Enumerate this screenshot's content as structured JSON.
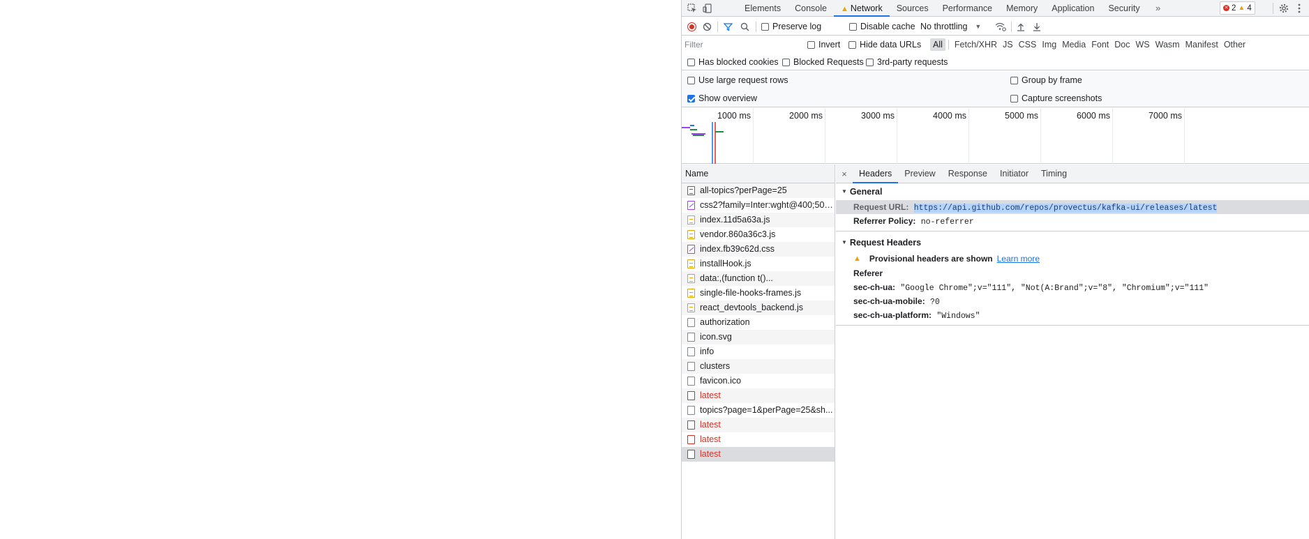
{
  "tabbar": {
    "tabs": [
      {
        "label": "Elements",
        "active": false
      },
      {
        "label": "Console",
        "active": false
      },
      {
        "label": "Network",
        "active": true
      },
      {
        "label": "Sources",
        "active": false
      },
      {
        "label": "Performance",
        "active": false
      },
      {
        "label": "Memory",
        "active": false
      },
      {
        "label": "Application",
        "active": false
      },
      {
        "label": "Security",
        "active": false
      }
    ],
    "overflow_label": "»",
    "error_count": "2",
    "warning_count": "4"
  },
  "toolbar": {
    "preserve_log_label": "Preserve log",
    "preserve_log_checked": false,
    "disable_cache_label": "Disable cache",
    "disable_cache_checked": false,
    "throttling_value": "No throttling"
  },
  "filter": {
    "placeholder": "Filter",
    "invert_label": "Invert",
    "hide_data_urls_label": "Hide data URLs",
    "types": [
      {
        "label": "All",
        "active": true
      },
      {
        "label": "Fetch/XHR",
        "active": false
      },
      {
        "label": "JS",
        "active": false
      },
      {
        "label": "CSS",
        "active": false
      },
      {
        "label": "Img",
        "active": false
      },
      {
        "label": "Media",
        "active": false
      },
      {
        "label": "Font",
        "active": false
      },
      {
        "label": "Doc",
        "active": false
      },
      {
        "label": "WS",
        "active": false
      },
      {
        "label": "Wasm",
        "active": false
      },
      {
        "label": "Manifest",
        "active": false
      },
      {
        "label": "Other",
        "active": false
      }
    ],
    "blocked_cookies_label": "Has blocked cookies",
    "blocked_requests_label": "Blocked Requests",
    "third_party_label": "3rd-party requests"
  },
  "settings": {
    "large_rows_label": "Use large request rows",
    "show_overview_label": "Show overview",
    "show_overview_checked": true,
    "group_by_frame_label": "Group by frame",
    "capture_screenshots_label": "Capture screenshots"
  },
  "overview": {
    "ticks": [
      "1000 ms",
      "2000 ms",
      "3000 ms",
      "4000 ms",
      "5000 ms",
      "6000 ms",
      "7000 ms"
    ]
  },
  "requests": {
    "header": "Name",
    "items": [
      {
        "name": "all-topics?perPage=25",
        "type": "doc",
        "error": false
      },
      {
        "name": "css2?family=Inter:wght@400;500...",
        "type": "css",
        "error": false
      },
      {
        "name": "index.11d5a63a.js",
        "type": "js",
        "error": false
      },
      {
        "name": "vendor.860a36c3.js",
        "type": "js",
        "error": false
      },
      {
        "name": "index.fb39c62d.css",
        "type": "css",
        "error": false
      },
      {
        "name": "installHook.js",
        "type": "js",
        "error": false
      },
      {
        "name": "data:,(function t()...",
        "type": "js",
        "error": false
      },
      {
        "name": "single-file-hooks-frames.js",
        "type": "js",
        "error": false
      },
      {
        "name": "react_devtools_backend.js",
        "type": "js",
        "error": false
      },
      {
        "name": "authorization",
        "type": "other",
        "error": false
      },
      {
        "name": "icon.svg",
        "type": "other",
        "error": false
      },
      {
        "name": "info",
        "type": "other",
        "error": false
      },
      {
        "name": "clusters",
        "type": "other",
        "error": false
      },
      {
        "name": "favicon.ico",
        "type": "other",
        "error": false
      },
      {
        "name": "latest",
        "type": "err",
        "error": true
      },
      {
        "name": "topics?page=1&perPage=25&sh...",
        "type": "other",
        "error": false
      },
      {
        "name": "latest",
        "type": "err",
        "error": true
      },
      {
        "name": "latest",
        "type": "err",
        "error": true
      },
      {
        "name": "latest",
        "type": "err",
        "error": true,
        "selected": true
      }
    ]
  },
  "details": {
    "close_label": "×",
    "tabs": [
      {
        "label": "Headers",
        "active": true
      },
      {
        "label": "Preview",
        "active": false
      },
      {
        "label": "Response",
        "active": false
      },
      {
        "label": "Initiator",
        "active": false
      },
      {
        "label": "Timing",
        "active": false
      }
    ],
    "general": {
      "title": "General",
      "request_url_key": "Request URL:",
      "request_url_value": "https://api.github.com/repos/provectus/kafka-ui/releases/latest",
      "referrer_policy_key": "Referrer Policy:",
      "referrer_policy_value": "no-referrer"
    },
    "request_headers": {
      "title": "Request Headers",
      "provisional_text": "Provisional headers are shown",
      "learn_more": "Learn more",
      "referer_key": "Referer",
      "sec_ch_ua_key": "sec-ch-ua:",
      "sec_ch_ua_value": "\"Google Chrome\";v=\"111\", \"Not(A:Brand\";v=\"8\", \"Chromium\";v=\"111\"",
      "sec_ch_ua_mobile_key": "sec-ch-ua-mobile:",
      "sec_ch_ua_mobile_value": "?0",
      "sec_ch_ua_platform_key": "sec-ch-ua-platform:",
      "sec_ch_ua_platform_value": "\"Windows\""
    }
  },
  "colors": {
    "accent": "#1a73e8",
    "error": "#d93025",
    "warning": "#e8a400"
  }
}
